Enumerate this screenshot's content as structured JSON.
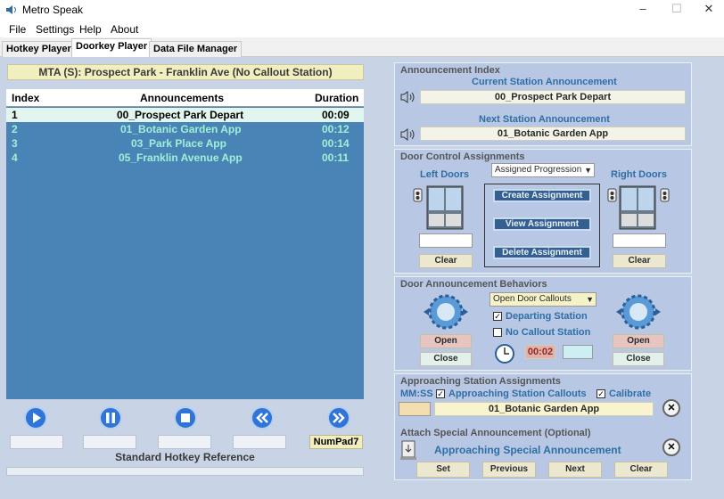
{
  "window": {
    "title": "Metro Speak",
    "min": "–",
    "max": "☐",
    "close": "✕"
  },
  "menu": [
    "File",
    "Settings",
    "Help",
    "About"
  ],
  "tabs": [
    "Hotkey Player",
    "Doorkey Player",
    "Data File Manager"
  ],
  "station_bar": "MTA (S): Prospect Park - Franklin Ave (No Callout Station)",
  "grid": {
    "headers": [
      "Index",
      "Announcements",
      "Duration"
    ],
    "rows": [
      {
        "index": "1",
        "name": "00_Prospect Park Depart",
        "duration": "00:09"
      },
      {
        "index": "2",
        "name": "01_Botanic Garden App",
        "duration": "00:12"
      },
      {
        "index": "3",
        "name": "03_Park Place App",
        "duration": "00:14"
      },
      {
        "index": "4",
        "name": "05_Franklin Avenue App",
        "duration": "00:11"
      }
    ]
  },
  "player": {
    "numpad": "NumPad7",
    "reference": "Standard Hotkey Reference"
  },
  "announcement_index": {
    "title": "Announcement Index",
    "current_label": "Current Station Announcement",
    "current_value": "00_Prospect Park Depart",
    "next_label": "Next Station Announcement",
    "next_value": "01_Botanic Garden App"
  },
  "door_control": {
    "title": "Door Control Assignments",
    "left_label": "Left Doors",
    "right_label": "Right Doors",
    "mode": "Assigned Progression",
    "create": "Create Assignment",
    "view": "View Assignment",
    "delete": "Delete Assignment",
    "clear": "Clear"
  },
  "door_behaviors": {
    "title": "Door Announcement Behaviors",
    "mode": "Open Door Callouts",
    "departing": "Departing Station",
    "no_callout": "No Callout Station",
    "timer": "00:02",
    "open": "Open",
    "close": "Close"
  },
  "approaching": {
    "title": "Approaching Station Assignments",
    "mmss": "MM:SS",
    "callouts": "Approaching Station Callouts",
    "calibrate": "Calibrate",
    "value": "01_Botanic Garden App",
    "special_title": "Attach Special Announcement (Optional)",
    "special_label": "Approaching Special Announcement",
    "set": "Set",
    "previous": "Previous",
    "next": "Next",
    "clear": "Clear",
    "x": "✕"
  },
  "colors": {
    "grid_bg": "#4a84b6",
    "accent": "#2e6ea6",
    "row_text": "#9ff0d6"
  }
}
